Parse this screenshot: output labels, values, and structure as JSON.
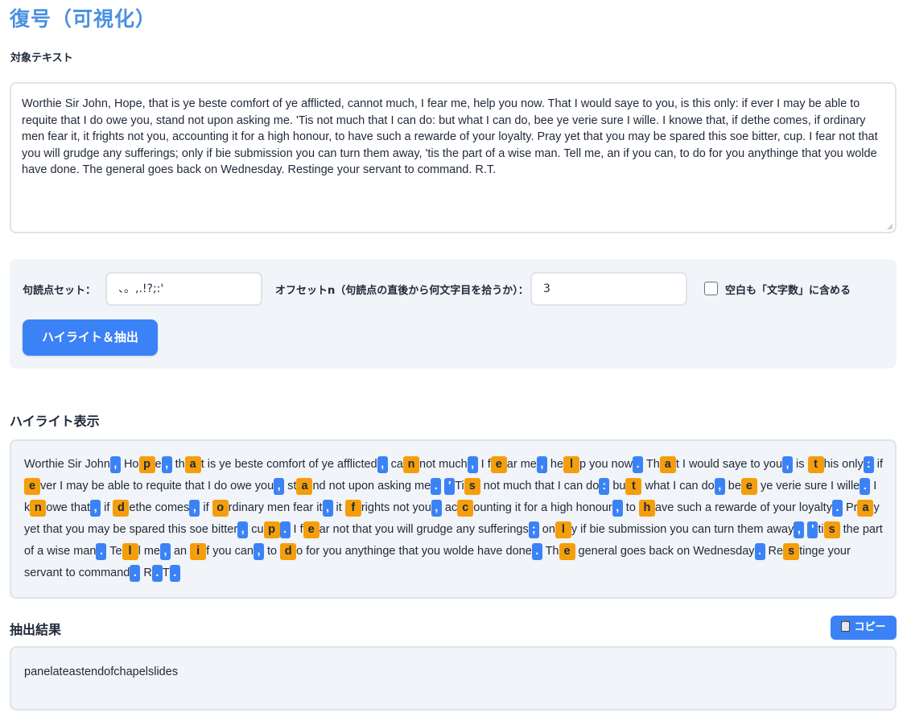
{
  "page": {
    "title": "復号（可視化）",
    "target_text_label": "対象テキスト",
    "target_text": "Worthie Sir John, Hope, that is ye beste comfort of ye afflicted, cannot much, I fear me, help you now. That I would saye to you, is this only: if ever I may be able to requite that I do owe you, stand not upon asking me. 'Tis not much that I can do: but what I can do, bee ye verie sure I wille. I knowe that, if dethe comes, if ordinary men fear it, it frights not you, accounting it for a high honour, to have such a rewarde of your loyalty. Pray yet that you may be spared this soe bitter, cup. I fear not that you will grudge any sufferings; only if bie submission you can turn them away, 'tis the part of a wise man. Tell me, an if you can, to do for you anythinge that you wolde have done. The general goes back on Wednesday. Restinge your servant to command. R.T."
  },
  "controls": {
    "punct_label": "句読点セット：",
    "punct_value": "、。,.!?;:'",
    "offset_label": "オフセットn（句読点の直後から何文字目を拾うか）：",
    "offset_value": "3",
    "space_checkbox_label": "空白も「文字数」に含める",
    "space_checkbox_checked": false,
    "highlight_button": "ハイライト＆抽出"
  },
  "highlight": {
    "title": "ハイライト表示",
    "segments": [
      [
        "t",
        "Worthie Sir John"
      ],
      [
        "p",
        ","
      ],
      [
        "t",
        " Ho"
      ],
      [
        "c",
        "p"
      ],
      [
        "t",
        "e"
      ],
      [
        "p",
        ","
      ],
      [
        "t",
        " th"
      ],
      [
        "c",
        "a"
      ],
      [
        "t",
        "t is ye beste comfort of ye afflicted"
      ],
      [
        "p",
        ","
      ],
      [
        "t",
        " ca"
      ],
      [
        "c",
        "n"
      ],
      [
        "t",
        "not much"
      ],
      [
        "p",
        ","
      ],
      [
        "t",
        " I f"
      ],
      [
        "c",
        "e"
      ],
      [
        "t",
        "ar me"
      ],
      [
        "p",
        ","
      ],
      [
        "t",
        " he"
      ],
      [
        "c",
        "l"
      ],
      [
        "t",
        "p you now"
      ],
      [
        "p",
        "."
      ],
      [
        "t",
        " Th"
      ],
      [
        "c",
        "a"
      ],
      [
        "t",
        "t I would saye to you"
      ],
      [
        "p",
        ","
      ],
      [
        "t",
        " is "
      ],
      [
        "c",
        "t"
      ],
      [
        "t",
        "his only"
      ],
      [
        "p",
        ":"
      ],
      [
        "t",
        " if "
      ],
      [
        "c",
        "e"
      ],
      [
        "t",
        "ver I may be able to requite that I do owe you"
      ],
      [
        "p",
        ","
      ],
      [
        "t",
        " st"
      ],
      [
        "c",
        "a"
      ],
      [
        "t",
        "nd not upon asking me"
      ],
      [
        "p",
        "."
      ],
      [
        "t",
        " "
      ],
      [
        "p",
        "'"
      ],
      [
        "t",
        "Ti"
      ],
      [
        "c",
        "s"
      ],
      [
        "t",
        " not much that I can do"
      ],
      [
        "p",
        ":"
      ],
      [
        "t",
        " bu"
      ],
      [
        "c",
        "t"
      ],
      [
        "t",
        " what I can do"
      ],
      [
        "p",
        ","
      ],
      [
        "t",
        " be"
      ],
      [
        "c",
        "e"
      ],
      [
        "t",
        " ye verie sure I wille"
      ],
      [
        "p",
        "."
      ],
      [
        "t",
        " I k"
      ],
      [
        "c",
        "n"
      ],
      [
        "t",
        "owe that"
      ],
      [
        "p",
        ","
      ],
      [
        "t",
        " if "
      ],
      [
        "c",
        "d"
      ],
      [
        "t",
        "ethe comes"
      ],
      [
        "p",
        ","
      ],
      [
        "t",
        " if "
      ],
      [
        "c",
        "o"
      ],
      [
        "t",
        "rdinary men fear it"
      ],
      [
        "p",
        ","
      ],
      [
        "t",
        " it "
      ],
      [
        "c",
        "f"
      ],
      [
        "t",
        "rights not you"
      ],
      [
        "p",
        ","
      ],
      [
        "t",
        " ac"
      ],
      [
        "c",
        "c"
      ],
      [
        "t",
        "ounting it for a high honour"
      ],
      [
        "p",
        ","
      ],
      [
        "t",
        " to "
      ],
      [
        "c",
        "h"
      ],
      [
        "t",
        "ave such a rewarde of your loyalty"
      ],
      [
        "p",
        "."
      ],
      [
        "t",
        " Pr"
      ],
      [
        "c",
        "a"
      ],
      [
        "t",
        "y yet that you may be spared this soe bitter"
      ],
      [
        "p",
        ","
      ],
      [
        "t",
        " cu"
      ],
      [
        "c",
        "p"
      ],
      [
        "p",
        "."
      ],
      [
        "t",
        " I f"
      ],
      [
        "c",
        "e"
      ],
      [
        "t",
        "ar not that you will grudge any sufferings"
      ],
      [
        "p",
        ";"
      ],
      [
        "t",
        " on"
      ],
      [
        "c",
        "l"
      ],
      [
        "t",
        "y if bie submission you can turn them away"
      ],
      [
        "p",
        ","
      ],
      [
        "t",
        " "
      ],
      [
        "p",
        "'"
      ],
      [
        "t",
        "ti"
      ],
      [
        "c",
        "s"
      ],
      [
        "t",
        " the part of a wise man"
      ],
      [
        "p",
        "."
      ],
      [
        "t",
        " Te"
      ],
      [
        "c",
        "l"
      ],
      [
        "t",
        "l me"
      ],
      [
        "p",
        ","
      ],
      [
        "t",
        " an "
      ],
      [
        "c",
        "i"
      ],
      [
        "t",
        "f you can"
      ],
      [
        "p",
        ","
      ],
      [
        "t",
        " to "
      ],
      [
        "c",
        "d"
      ],
      [
        "t",
        "o for you anythinge that you wolde have done"
      ],
      [
        "p",
        "."
      ],
      [
        "t",
        " Th"
      ],
      [
        "c",
        "e"
      ],
      [
        "t",
        " general goes back on Wednesday"
      ],
      [
        "p",
        "."
      ],
      [
        "t",
        " Re"
      ],
      [
        "c",
        "s"
      ],
      [
        "t",
        "tinge your servant to command"
      ],
      [
        "p",
        "."
      ],
      [
        "t",
        " R"
      ],
      [
        "p",
        "."
      ],
      [
        "t",
        "T"
      ],
      [
        "p",
        "."
      ]
    ]
  },
  "result": {
    "title": "抽出結果",
    "copy_button": "コピー",
    "copy_icon": "clipboard-icon",
    "value": "panelateastendofchapelslides"
  },
  "colors": {
    "accent": "#3b82f6",
    "title": "#4a90e2",
    "highlight_char": "#f59e0b",
    "panel_bg": "#f1f4f8"
  }
}
